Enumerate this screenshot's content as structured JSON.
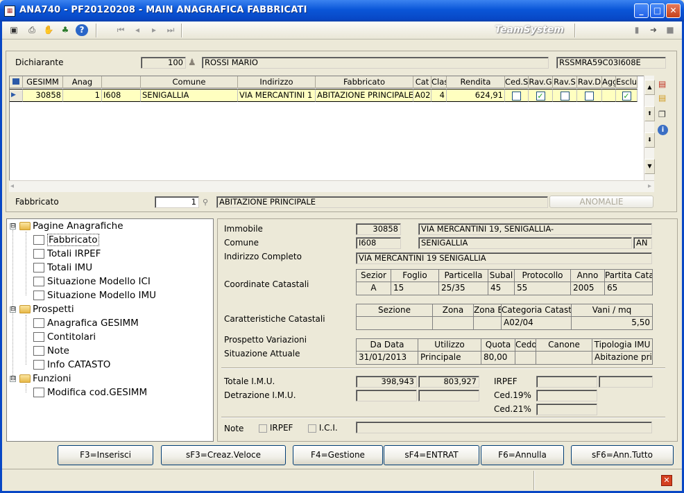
{
  "window": {
    "title": "ANA740  - PF20120208 - MAIN ANAGRAFICA FABBRICATI",
    "minimize": "_",
    "maximize": "□",
    "close": "✕"
  },
  "toolbar": {
    "brand": "TeamSystem",
    "icons": [
      "monitor-icon",
      "printer-icon",
      "hand-icon",
      "tree-icon",
      "help-icon",
      "first-icon",
      "prev-icon",
      "next-icon",
      "last-icon",
      "book-icon",
      "forward-icon",
      "stop-icon"
    ]
  },
  "header": {
    "dichiarante_label": "Dichiarante",
    "dichiarante_code": "100",
    "dichiarante_name": "ROSSI MARIO",
    "codice_fiscale": "RSSMRA59C03I608E"
  },
  "grid": {
    "columns": [
      "GESIMM",
      "Anag",
      "",
      "Comune",
      "Indirizzo",
      "Fabbricato",
      "Cat",
      "Clas",
      "Rendita",
      "Ced.S",
      "Rav.G",
      "Rav.S",
      "Rav.D",
      "Agg",
      "Esclu"
    ],
    "row": {
      "gesimm": "30858",
      "anag": "1",
      "code": "I608",
      "comune": "SENIGALLIA",
      "indirizzo": "VIA MERCANTINI 1",
      "fabbricato": "ABITAZIONE PRINCIPALE",
      "cat": "A02",
      "clas": "4",
      "rendita": "624,91",
      "ced_s": false,
      "rav_g": true,
      "rav_s": false,
      "rav_d": false,
      "esclu": true
    }
  },
  "fabbricato_bar": {
    "label": "Fabbricato",
    "value": "1",
    "description": "ABITAZIONE PRINCIPALE",
    "anomalie": "ANOMALIE"
  },
  "tree": {
    "groups": [
      {
        "label": "Pagine Anagrafiche",
        "items": [
          "Fabbricato",
          "Totali IRPEF",
          "Totali IMU",
          "Situazione Modello ICI",
          "Situazione Modello IMU"
        ]
      },
      {
        "label": "Prospetti",
        "items": [
          "Anagrafica GESIMM",
          "Contitolari",
          "Note",
          "Info CATASTO"
        ]
      },
      {
        "label": "Funzioni",
        "items": [
          "Modifica cod.GESIMM"
        ]
      }
    ],
    "expander": "⊟"
  },
  "detail": {
    "immobile_label": "Immobile",
    "immobile_code": "30858",
    "immobile_addr": "VIA MERCANTINI 19, SENIGALLIA-",
    "comune_label": "Comune",
    "comune_code": "I608",
    "comune_name": "SENIGALLIA",
    "comune_prov": "AN",
    "indirizzo_label": "Indirizzo Completo",
    "indirizzo_value": "VIA MERCANTINI 19 SENIGALLIA",
    "coord_label": "Coordinate Catastali",
    "coord_headers": [
      "Sezior",
      "Foglio",
      "Particella",
      "Subal",
      "Protocollo",
      "Anno",
      "Partita Cata"
    ],
    "coord_values": [
      "A",
      "15",
      "25/35",
      "45",
      "55",
      "2005",
      "65"
    ],
    "caratt_label": "Caratteristiche Catastali",
    "caratt_headers": [
      "Sezione",
      "Zona",
      "Zona E",
      "Categoria Catast",
      "Vani / mq"
    ],
    "caratt_values": [
      "",
      "",
      "",
      "A02/04",
      "5,50"
    ],
    "prospetto_label": "Prospetto Variazioni",
    "situazione_label": "Situazione Attuale",
    "sit_headers": [
      "Da Data",
      "Utilizzo",
      "Quota",
      "Cedo",
      "Canone",
      "Tipologia IMU"
    ],
    "sit_values": [
      "31/01/2013",
      "Principale",
      "80,00",
      "",
      "",
      "Abitazione prir"
    ],
    "totale_label": "Totale I.M.U.",
    "totale_v1": "398,943",
    "totale_v2": "803,927",
    "detrazione_label": "Detrazione I.M.U.",
    "irpef_label": "IRPEF",
    "ced19_label": "Ced.19%",
    "ced21_label": "Ced.21%",
    "note_label": "Note",
    "note_irpef": "IRPEF",
    "note_ici": "I.C.I."
  },
  "buttons": [
    "F3=Inserisci",
    "sF3=Creaz.Veloce",
    "F4=Gestione",
    "sF4=ENTRAT",
    "F6=Annulla",
    "sF6=Ann.Tutto"
  ],
  "side_icons": [
    "delete-row-icon",
    "add-row-icon",
    "window-icon",
    "info-icon"
  ]
}
